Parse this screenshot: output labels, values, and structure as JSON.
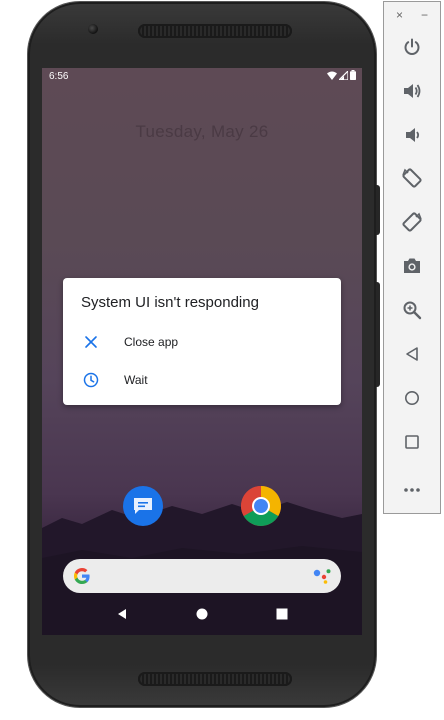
{
  "status_bar": {
    "time": "6:56"
  },
  "lockscreen": {
    "date": "Tuesday, May 26"
  },
  "dialog": {
    "title": "System UI isn't responding",
    "options": [
      {
        "label": "Close app",
        "icon": "close-icon"
      },
      {
        "label": "Wait",
        "icon": "clock-icon"
      }
    ]
  },
  "home": {
    "apps": [
      {
        "icon": "messages-icon"
      },
      {
        "icon": "chrome-icon"
      }
    ],
    "search_bar": {
      "logo": "google-g-icon",
      "assistant": "google-assistant-icon"
    }
  },
  "navbar": {
    "buttons": [
      "back-icon",
      "home-icon",
      "recents-icon"
    ]
  },
  "emulator_sidebar": {
    "window_controls": {
      "close": "×",
      "minimize": "−"
    },
    "buttons": [
      "power",
      "volume-up",
      "volume-down",
      "rotate-left",
      "rotate-right",
      "screenshot",
      "zoom",
      "back",
      "home",
      "overview",
      "more"
    ]
  },
  "colors": {
    "accent": "#1a73e8",
    "dialog_bg": "#ffffff",
    "panel_bg": "#f3f3f3"
  }
}
